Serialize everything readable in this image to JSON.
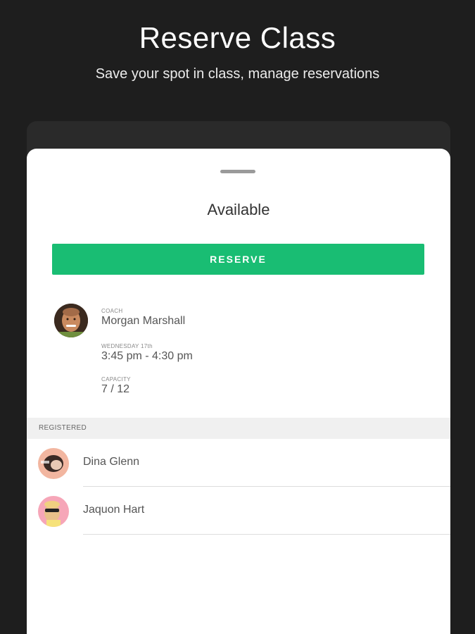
{
  "hero": {
    "title": "Reserve Class",
    "subtitle": "Save your spot in class, manage reservations"
  },
  "sheet": {
    "status": "Available",
    "reserve_label": "RESERVE"
  },
  "details": {
    "coach_label": "COACH",
    "coach_name": "Morgan Marshall",
    "date_label": "WEDNESDAY 17th",
    "time": "3:45 pm - 4:30 pm",
    "capacity_label": "CAPACITY",
    "capacity": "7 / 12"
  },
  "registered": {
    "label": "REGISTERED",
    "people": [
      {
        "name": "Dina Glenn"
      },
      {
        "name": "Jaquon Hart"
      }
    ]
  },
  "colors": {
    "background": "#1e1e1e",
    "accent": "#19bd73",
    "sheet": "#ffffff"
  }
}
